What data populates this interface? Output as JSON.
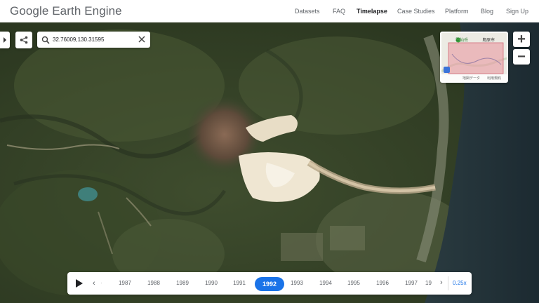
{
  "header": {
    "logo": "Google Earth Engine",
    "nav": [
      {
        "label": "Datasets",
        "active": false
      },
      {
        "label": "FAQ",
        "active": false
      },
      {
        "label": "Timelapse",
        "active": true
      },
      {
        "label": "Case Studies",
        "active": false
      },
      {
        "label": "Platform",
        "active": false
      },
      {
        "label": "Blog",
        "active": false
      },
      {
        "label": "Sign Up",
        "active": false
      }
    ]
  },
  "search": {
    "value": "32.76009,130.31595"
  },
  "zoom": {
    "in_label": "+",
    "out_label": "−"
  },
  "minimap": {
    "place_a": "雲仙岳",
    "place_b": "島原市",
    "footer_a": "地図データ",
    "footer_b": "利用規約"
  },
  "timeline": {
    "years": [
      "1987",
      "1988",
      "1989",
      "1990",
      "1991",
      "1992",
      "1993",
      "1994",
      "1995",
      "1996",
      "1997",
      "19"
    ],
    "selected_year": "1992",
    "speed": "0.25x"
  },
  "colors": {
    "accent": "#1a73e8"
  }
}
